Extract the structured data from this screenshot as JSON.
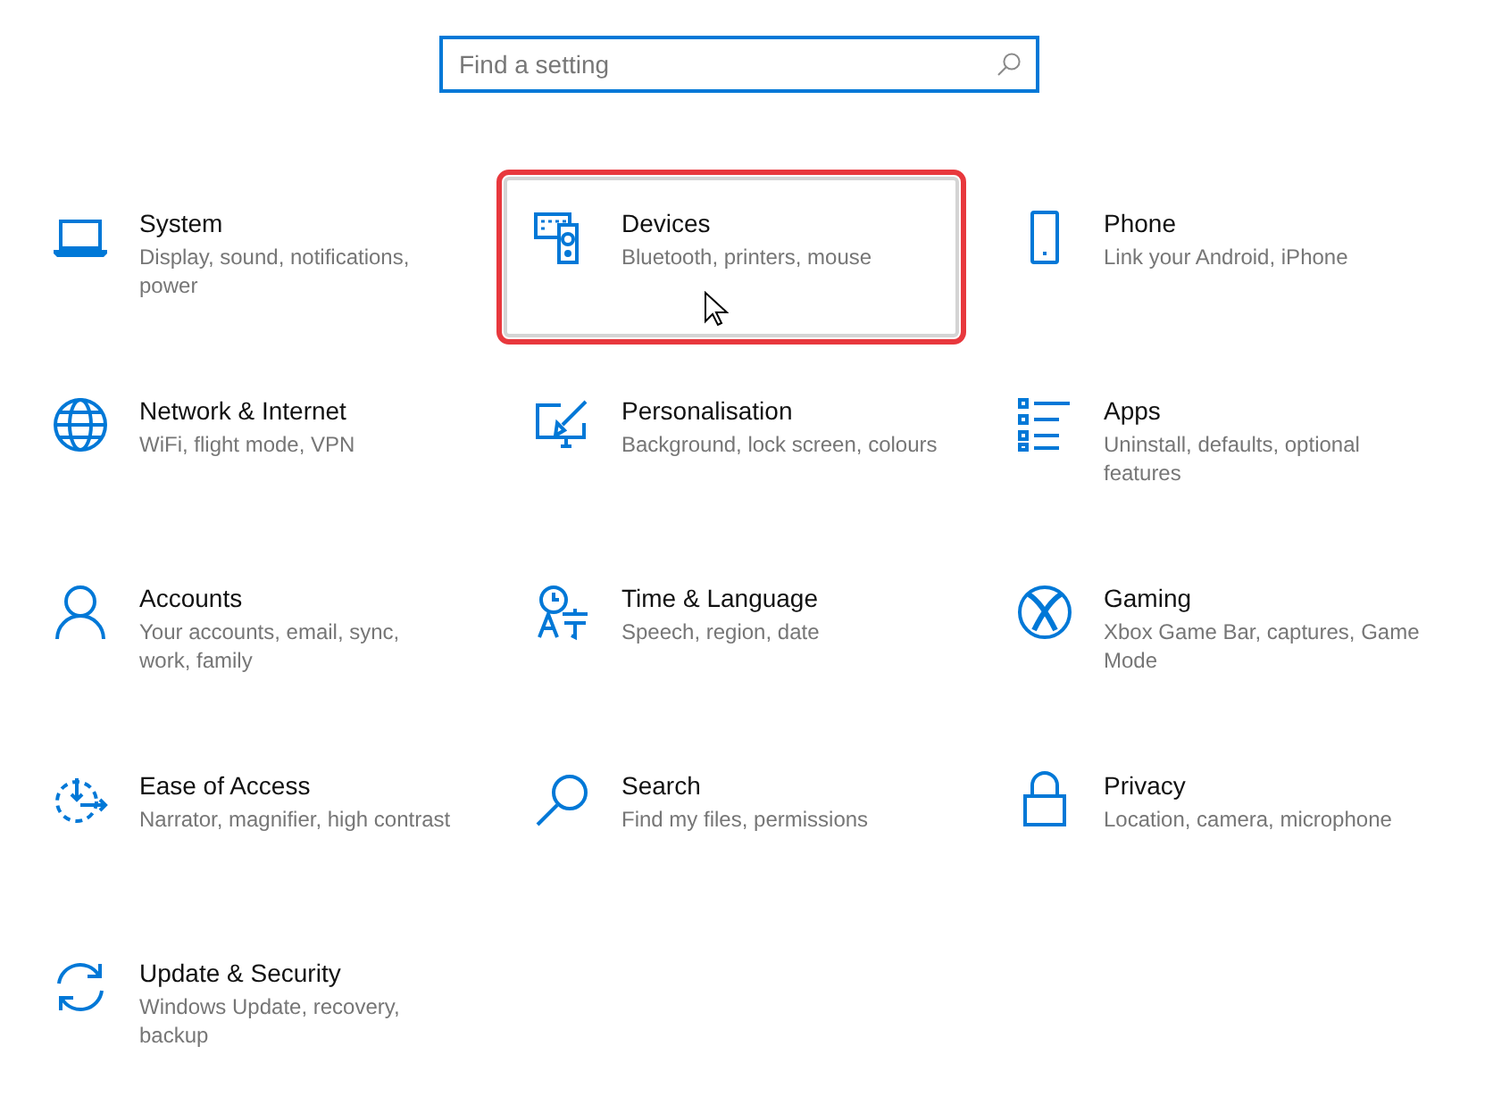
{
  "search": {
    "placeholder": "Find a setting"
  },
  "tiles": [
    {
      "kind": "laptop",
      "title": "System",
      "description": "Display, sound, notifications, power",
      "hovered": false,
      "outlined": false
    },
    {
      "kind": "devices",
      "title": "Devices",
      "description": "Bluetooth, printers, mouse",
      "hovered": true,
      "outlined": true
    },
    {
      "kind": "phone",
      "title": "Phone",
      "description": "Link your Android, iPhone",
      "hovered": false,
      "outlined": false
    },
    {
      "kind": "globe",
      "title": "Network & Internet",
      "description": "WiFi, flight mode, VPN",
      "hovered": false,
      "outlined": false
    },
    {
      "kind": "brush",
      "title": "Personalisation",
      "description": "Background, lock screen, colours",
      "hovered": false,
      "outlined": false
    },
    {
      "kind": "apps",
      "title": "Apps",
      "description": "Uninstall, defaults, optional features",
      "hovered": false,
      "outlined": false
    },
    {
      "kind": "person",
      "title": "Accounts",
      "description": "Your accounts, email, sync, work, family",
      "hovered": false,
      "outlined": false
    },
    {
      "kind": "language",
      "title": "Time & Language",
      "description": "Speech, region, date",
      "hovered": false,
      "outlined": false
    },
    {
      "kind": "xbox",
      "title": "Gaming",
      "description": "Xbox Game Bar, captures, Game Mode",
      "hovered": false,
      "outlined": false
    },
    {
      "kind": "ease",
      "title": "Ease of Access",
      "description": "Narrator, magnifier, high contrast",
      "hovered": false,
      "outlined": false
    },
    {
      "kind": "search",
      "title": "Search",
      "description": "Find my files, permissions",
      "hovered": false,
      "outlined": false
    },
    {
      "kind": "lock",
      "title": "Privacy",
      "description": "Location, camera, microphone",
      "hovered": false,
      "outlined": false
    },
    {
      "kind": "update",
      "title": "Update & Security",
      "description": "Windows Update, recovery, backup",
      "hovered": false,
      "outlined": false
    }
  ]
}
